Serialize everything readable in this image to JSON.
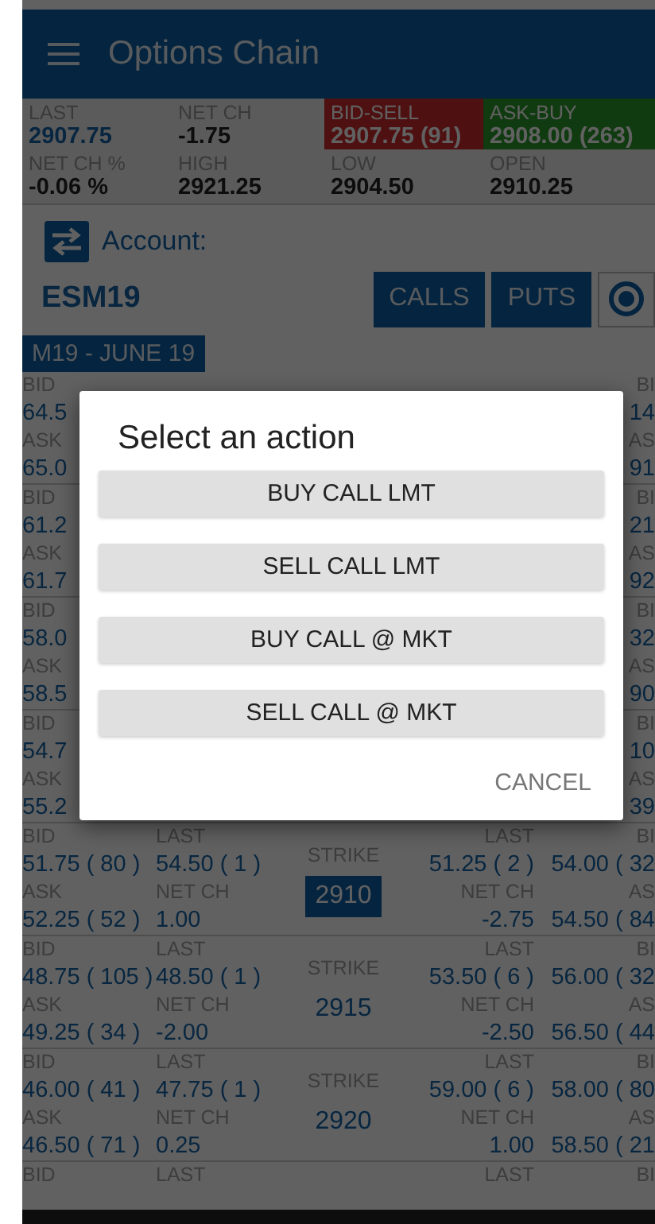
{
  "app_bar": {
    "title": "Options Chain"
  },
  "quote": [
    {
      "kind": "last",
      "label": "LAST",
      "value": "2907.75"
    },
    {
      "kind": "plain",
      "label": "NET CH",
      "value": "-1.75"
    },
    {
      "kind": "bid",
      "label": "BID-SELL",
      "value": "2907.75 (91)"
    },
    {
      "kind": "ask",
      "label": "ASK-BUY",
      "value": "2908.00 (263)"
    },
    {
      "kind": "plain",
      "label": "NET CH %",
      "value": "-0.06 %"
    },
    {
      "kind": "plain",
      "label": "HIGH",
      "value": "2921.25"
    },
    {
      "kind": "plain",
      "label": "LOW",
      "value": "2904.50"
    },
    {
      "kind": "plain",
      "label": "OPEN",
      "value": "2910.25"
    }
  ],
  "account": {
    "label": "Account:"
  },
  "symbol": "ESM19",
  "view_buttons": [
    {
      "label": "CALLS"
    },
    {
      "label": "PUTS"
    }
  ],
  "expiry_tab": {
    "label": "M19 - JUNE 19"
  },
  "rows": [
    {
      "cells": [
        {
          "kind": "call_bid",
          "lines": [
            {
              "kind": "label",
              "text": "BID"
            },
            {
              "kind": "value",
              "text": "64.5"
            },
            {
              "kind": "label",
              "text": "ASK"
            },
            {
              "kind": "value",
              "text": "65.0"
            }
          ]
        },
        {
          "kind": "put_bid",
          "lines": [
            {
              "kind": "label",
              "text": "BI"
            },
            {
              "kind": "value",
              "text": "14"
            },
            {
              "kind": "label",
              "text": "AS"
            },
            {
              "kind": "value",
              "text": "91"
            }
          ]
        }
      ]
    },
    {
      "cells": [
        {
          "kind": "call_bid",
          "lines": [
            {
              "kind": "label",
              "text": "BID"
            },
            {
              "kind": "value",
              "text": "61.2"
            },
            {
              "kind": "label",
              "text": "ASK"
            },
            {
              "kind": "value",
              "text": "61.7"
            }
          ]
        },
        {
          "kind": "put_bid",
          "lines": [
            {
              "kind": "label",
              "text": "BI"
            },
            {
              "kind": "value",
              "text": "21"
            },
            {
              "kind": "label",
              "text": "AS"
            },
            {
              "kind": "value",
              "text": "92"
            }
          ]
        }
      ]
    },
    {
      "cells": [
        {
          "kind": "call_bid",
          "lines": [
            {
              "kind": "label",
              "text": "BID"
            },
            {
              "kind": "value",
              "text": "58.0"
            },
            {
              "kind": "label",
              "text": "ASK"
            },
            {
              "kind": "value",
              "text": "58.5"
            }
          ]
        },
        {
          "kind": "put_bid",
          "lines": [
            {
              "kind": "label",
              "text": "BI"
            },
            {
              "kind": "value",
              "text": "32"
            },
            {
              "kind": "label",
              "text": "AS"
            },
            {
              "kind": "value",
              "text": "90"
            }
          ]
        }
      ]
    },
    {
      "cells": [
        {
          "kind": "call_bid",
          "lines": [
            {
              "kind": "label",
              "text": "BID"
            },
            {
              "kind": "value",
              "text": "54.7"
            },
            {
              "kind": "label",
              "text": "ASK"
            },
            {
              "kind": "value",
              "text": "55.2"
            }
          ]
        },
        {
          "kind": "put_bid",
          "lines": [
            {
              "kind": "label",
              "text": "BI"
            },
            {
              "kind": "value",
              "text": "10"
            },
            {
              "kind": "label",
              "text": "AS"
            },
            {
              "kind": "value",
              "text": "39"
            }
          ]
        }
      ]
    },
    {
      "cells": [
        {
          "kind": "call_bid",
          "lines": [
            {
              "kind": "label",
              "text": "BID"
            },
            {
              "kind": "value",
              "text": "51.75 ( 80 )"
            },
            {
              "kind": "label",
              "text": "ASK"
            },
            {
              "kind": "value",
              "text": "52.25 ( 52 )"
            }
          ]
        },
        {
          "kind": "call_last",
          "lines": [
            {
              "kind": "label",
              "text": "LAST"
            },
            {
              "kind": "value",
              "text": "54.50 ( 1 )"
            },
            {
              "kind": "label",
              "text": "NET CH"
            },
            {
              "kind": "value",
              "text": "1.00"
            }
          ]
        },
        {
          "kind": "strike",
          "lines": [
            {
              "kind": "label",
              "text": "STRIKE"
            },
            {
              "kind": "strike",
              "text": "2910",
              "selected": true
            }
          ]
        },
        {
          "kind": "put_last",
          "lines": [
            {
              "kind": "label",
              "text": "LAST"
            },
            {
              "kind": "value",
              "text": "51.25 ( 2 )"
            },
            {
              "kind": "label",
              "text": "NET CH"
            },
            {
              "kind": "value",
              "text": "-2.75"
            }
          ]
        },
        {
          "kind": "put_bid",
          "lines": [
            {
              "kind": "label",
              "text": "BI"
            },
            {
              "kind": "value",
              "text": "54.00 ( 32"
            },
            {
              "kind": "label",
              "text": "AS"
            },
            {
              "kind": "value",
              "text": "54.50 ( 84"
            }
          ]
        }
      ]
    },
    {
      "cells": [
        {
          "kind": "call_bid",
          "lines": [
            {
              "kind": "label",
              "text": "BID"
            },
            {
              "kind": "value",
              "text": "48.75 ( 105 )"
            },
            {
              "kind": "label",
              "text": "ASK"
            },
            {
              "kind": "value",
              "text": "49.25 ( 34 )"
            }
          ]
        },
        {
          "kind": "call_last",
          "lines": [
            {
              "kind": "label",
              "text": "LAST"
            },
            {
              "kind": "value",
              "text": "48.50 ( 1 )"
            },
            {
              "kind": "label",
              "text": "NET CH"
            },
            {
              "kind": "value",
              "text": "-2.00"
            }
          ]
        },
        {
          "kind": "strike",
          "lines": [
            {
              "kind": "label",
              "text": "STRIKE"
            },
            {
              "kind": "strike",
              "text": "2915",
              "selected": false
            }
          ]
        },
        {
          "kind": "put_last",
          "lines": [
            {
              "kind": "label",
              "text": "LAST"
            },
            {
              "kind": "value",
              "text": "53.50 ( 6 )"
            },
            {
              "kind": "label",
              "text": "NET CH"
            },
            {
              "kind": "value",
              "text": "-2.50"
            }
          ]
        },
        {
          "kind": "put_bid",
          "lines": [
            {
              "kind": "label",
              "text": "BI"
            },
            {
              "kind": "value",
              "text": "56.00 ( 32"
            },
            {
              "kind": "label",
              "text": "AS"
            },
            {
              "kind": "value",
              "text": "56.50 ( 44"
            }
          ]
        }
      ]
    },
    {
      "cells": [
        {
          "kind": "call_bid",
          "lines": [
            {
              "kind": "label",
              "text": "BID"
            },
            {
              "kind": "value",
              "text": "46.00 ( 41 )"
            },
            {
              "kind": "label",
              "text": "ASK"
            },
            {
              "kind": "value",
              "text": "46.50 ( 71 )"
            }
          ]
        },
        {
          "kind": "call_last",
          "lines": [
            {
              "kind": "label",
              "text": "LAST"
            },
            {
              "kind": "value",
              "text": "47.75 ( 1 )"
            },
            {
              "kind": "label",
              "text": "NET CH"
            },
            {
              "kind": "value",
              "text": "0.25"
            }
          ]
        },
        {
          "kind": "strike",
          "lines": [
            {
              "kind": "label",
              "text": "STRIKE"
            },
            {
              "kind": "strike",
              "text": "2920",
              "selected": false
            }
          ]
        },
        {
          "kind": "put_last",
          "lines": [
            {
              "kind": "label",
              "text": "LAST"
            },
            {
              "kind": "value",
              "text": "59.00 ( 6 )"
            },
            {
              "kind": "label",
              "text": "NET CH"
            },
            {
              "kind": "value",
              "text": "1.00"
            }
          ]
        },
        {
          "kind": "put_bid",
          "lines": [
            {
              "kind": "label",
              "text": "BI"
            },
            {
              "kind": "value",
              "text": "58.00 ( 80"
            },
            {
              "kind": "label",
              "text": "AS"
            },
            {
              "kind": "value",
              "text": "58.50 ( 21"
            }
          ]
        }
      ]
    },
    {
      "cells": [
        {
          "kind": "call_bid",
          "lines": [
            {
              "kind": "label",
              "text": "BID"
            }
          ]
        },
        {
          "kind": "call_last",
          "lines": [
            {
              "kind": "label",
              "text": "LAST"
            }
          ]
        },
        {
          "kind": "put_last",
          "lines": [
            {
              "kind": "label",
              "text": "LAST"
            }
          ]
        },
        {
          "kind": "put_bid",
          "lines": [
            {
              "kind": "label",
              "text": "BI"
            }
          ]
        }
      ]
    }
  ],
  "dialog": {
    "title": "Select an action",
    "actions": [
      {
        "label": "BUY CALL LMT"
      },
      {
        "label": "SELL CALL LMT"
      },
      {
        "label": "BUY CALL @ MKT"
      },
      {
        "label": "SELL CALL @ MKT"
      }
    ],
    "cancel": "CANCEL"
  }
}
